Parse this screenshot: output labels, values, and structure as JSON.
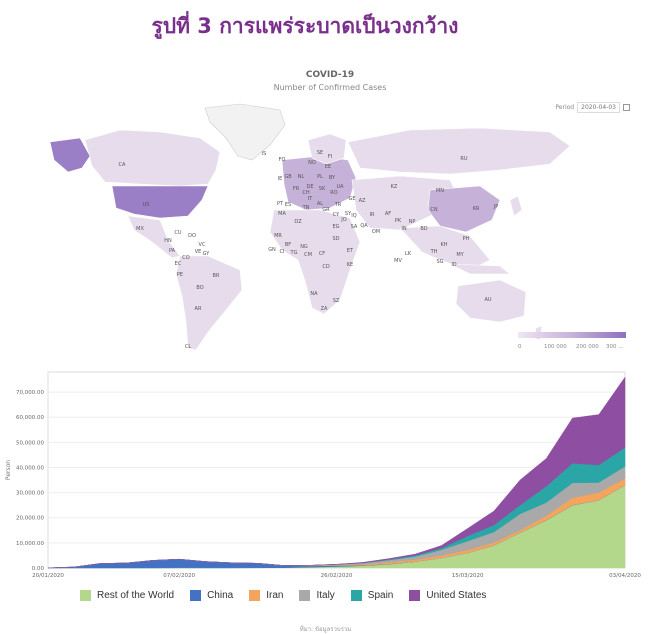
{
  "page": {
    "title": "รูปที่ 3 การแพร่ระบาดเป็นวงกว้าง"
  },
  "map": {
    "title": "COVID-19",
    "subtitle": "Number of Confirmed Cases",
    "period_label": "Period",
    "period_value": "2020-04-03",
    "legend_ticks": [
      "0",
      "100 000",
      "200 000",
      "300 ..."
    ],
    "colors": {
      "low": "#e6dceb",
      "mid": "#c6b2d8",
      "high": "#9a7ec6"
    },
    "country_labels": [
      "IS",
      "FO",
      "SE",
      "FI",
      "NO",
      "EE",
      "RU",
      "IE",
      "GB",
      "NL",
      "PL",
      "BY",
      "UA",
      "FR",
      "CH",
      "DE",
      "SK",
      "RO",
      "KZ",
      "MN",
      "PT",
      "ES",
      "IT",
      "AL",
      "GR",
      "TR",
      "GE",
      "AZ",
      "US",
      "CA",
      "MA",
      "TN",
      "CY",
      "SY",
      "IQ",
      "IR",
      "AF",
      "PK",
      "CN",
      "KR",
      "JP",
      "MX",
      "CU",
      "DO",
      "DZ",
      "EG",
      "JO",
      "SA",
      "QA",
      "OM",
      "IN",
      "NP",
      "BD",
      "HN",
      "VC",
      "MR",
      "SD",
      "KH",
      "PH",
      "PA",
      "CO",
      "VE",
      "GY",
      "GN",
      "BF",
      "NG",
      "CM",
      "ET",
      "LK",
      "TH",
      "MY",
      "EC",
      "CI",
      "TG",
      "CF",
      "KE",
      "MV",
      "SG",
      "ID",
      "PE",
      "BR",
      "CD",
      "BO",
      "NA",
      "SZ",
      "AU",
      "AR",
      "ZA",
      "CL"
    ]
  },
  "chart_data": {
    "type": "area",
    "stacked": true,
    "ylabel": "Person",
    "x": [
      "20/01/2020",
      "23/01/2020",
      "27/01/2020",
      "30/01/2020",
      "03/02/2020",
      "07/02/2020",
      "10/02/2020",
      "13/02/2020",
      "17/02/2020",
      "20/02/2020",
      "23/02/2020",
      "26/02/2020",
      "01/03/2020",
      "05/03/2020",
      "08/03/2020",
      "11/03/2020",
      "15/03/2020",
      "18/03/2020",
      "21/03/2020",
      "24/03/2020",
      "27/03/2020",
      "30/03/2020",
      "03/04/2020"
    ],
    "x_ticks": [
      "20/01/2020",
      "07/02/2020",
      "26/02/2020",
      "15/03/2020",
      "03/04/2020"
    ],
    "y_ticks": [
      "0.00",
      "10,000.00",
      "20,000.00",
      "30,000.00",
      "40,000.00",
      "50,000.00",
      "60,000.00",
      "70,000.00"
    ],
    "ylim": [
      0,
      78000
    ],
    "series": [
      {
        "name": "Rest of the World",
        "color": "#b3d78b",
        "values": [
          0,
          0,
          0,
          0,
          10,
          20,
          30,
          50,
          80,
          120,
          300,
          600,
          900,
          1500,
          2500,
          4000,
          6000,
          9000,
          14000,
          19000,
          25000,
          27000,
          33000
        ]
      },
      {
        "name": "China",
        "color": "#4372c4",
        "values": [
          50,
          400,
          1800,
          2000,
          3000,
          3500,
          2500,
          2000,
          1800,
          800,
          500,
          400,
          150,
          140,
          40,
          30,
          20,
          30,
          40,
          70,
          60,
          40,
          30
        ]
      },
      {
        "name": "Iran",
        "color": "#f4a45c",
        "values": [
          0,
          0,
          0,
          0,
          0,
          0,
          0,
          0,
          0,
          10,
          70,
          140,
          400,
          700,
          800,
          900,
          1200,
          1100,
          1000,
          1700,
          2900,
          3000,
          2600
        ]
      },
      {
        "name": "Italy",
        "color": "#a9a9a9",
        "values": [
          0,
          0,
          0,
          0,
          0,
          0,
          0,
          0,
          0,
          50,
          200,
          300,
          500,
          800,
          1200,
          2300,
          3500,
          4200,
          6500,
          5300,
          5900,
          4000,
          4800
        ]
      },
      {
        "name": "Spain",
        "color": "#2aa6a7",
        "values": [
          0,
          0,
          0,
          0,
          0,
          0,
          0,
          0,
          0,
          0,
          10,
          20,
          80,
          300,
          500,
          700,
          2000,
          2800,
          3500,
          6500,
          7800,
          7000,
          7500
        ]
      },
      {
        "name": "United States",
        "color": "#8e4ea2",
        "values": [
          0,
          0,
          0,
          0,
          0,
          0,
          0,
          0,
          0,
          0,
          10,
          20,
          200,
          300,
          500,
          1000,
          3000,
          5500,
          10000,
          11000,
          18000,
          20000,
          28000
        ]
      }
    ]
  },
  "footer": {
    "text": "ที่มา: ข้อมูลรวบรวม"
  }
}
